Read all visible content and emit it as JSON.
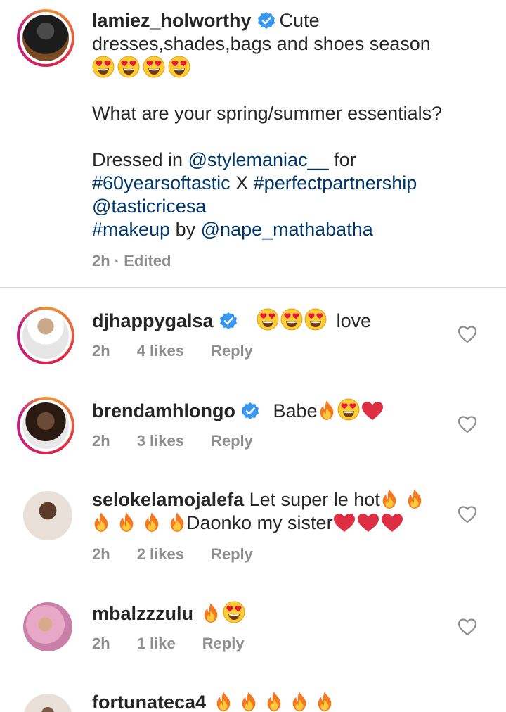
{
  "caption": {
    "username": "lamiez_holworthy",
    "line1_text": "Cute",
    "line2_text": "dresses,shades,bags and shoes season",
    "line3_text": "What are your spring/summer essentials?",
    "line4_text": "Dressed in",
    "mention1": "@stylemaniac__",
    "line4_after": "for",
    "hashtag1": "#60yearsoftastic",
    "line5_mid": "X",
    "hashtag2": "#perfectpartnership",
    "mention2": "@tasticricesa",
    "hashtag3": "#makeup",
    "line7_mid": "by",
    "mention3": "@nape_mathabatha",
    "meta": "2h · Edited"
  },
  "comments": [
    {
      "username": "djhappygalsa",
      "text": "love",
      "time": "2h",
      "likes": "4 likes",
      "reply": "Reply"
    },
    {
      "username": "brendamhlongo",
      "text": "Babe",
      "time": "2h",
      "likes": "3 likes",
      "reply": "Reply"
    },
    {
      "username": "selokelamojalefa",
      "text": "Let super le hot",
      "text2": "Daonko my sister",
      "time": "2h",
      "likes": "2 likes",
      "reply": "Reply"
    },
    {
      "username": "mbalzzzulu",
      "text": "",
      "time": "2h",
      "likes": "1 like",
      "reply": "Reply"
    },
    {
      "username": "fortunateca4",
      "text": ""
    }
  ],
  "colors": {
    "link": "#00376b",
    "verified": "#3897f0",
    "meta": "#8e8e8e",
    "divider": "#dbdbdb"
  },
  "icons": [
    "verified-badge-icon",
    "heart-eyes-emoji",
    "fire-emoji",
    "red-heart-emoji",
    "like-heart-icon"
  ]
}
